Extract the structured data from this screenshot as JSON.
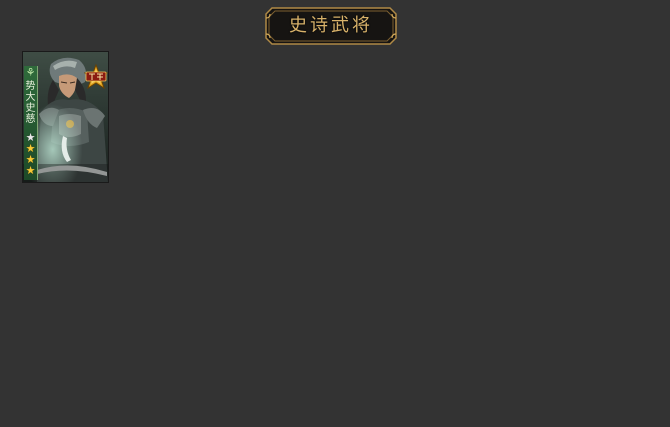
{
  "header": {
    "title": "史诗武将"
  },
  "card": {
    "faction_icon": "leaf-faction-icon",
    "name": "势大史慈",
    "rarity_badge": "epic-badge-icon",
    "stars": [
      {
        "filled": false
      },
      {
        "filled": true
      },
      {
        "filled": true
      },
      {
        "filled": true
      }
    ]
  },
  "colors": {
    "background": "#333333",
    "title_gold": "#d8b26a",
    "faction_green": "#2f6b3b",
    "star_gold": "#f6c935"
  }
}
